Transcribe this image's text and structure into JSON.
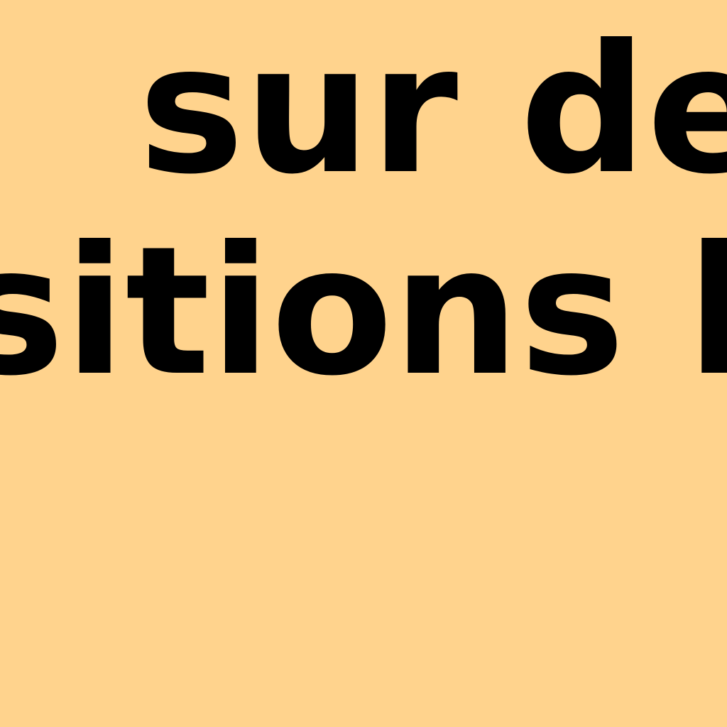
{
  "zoomed_text": {
    "line_1": " sur dem",
    "line_2": "sitions le"
  },
  "colors": {
    "background": "#FFD38D",
    "text": "#000000"
  }
}
